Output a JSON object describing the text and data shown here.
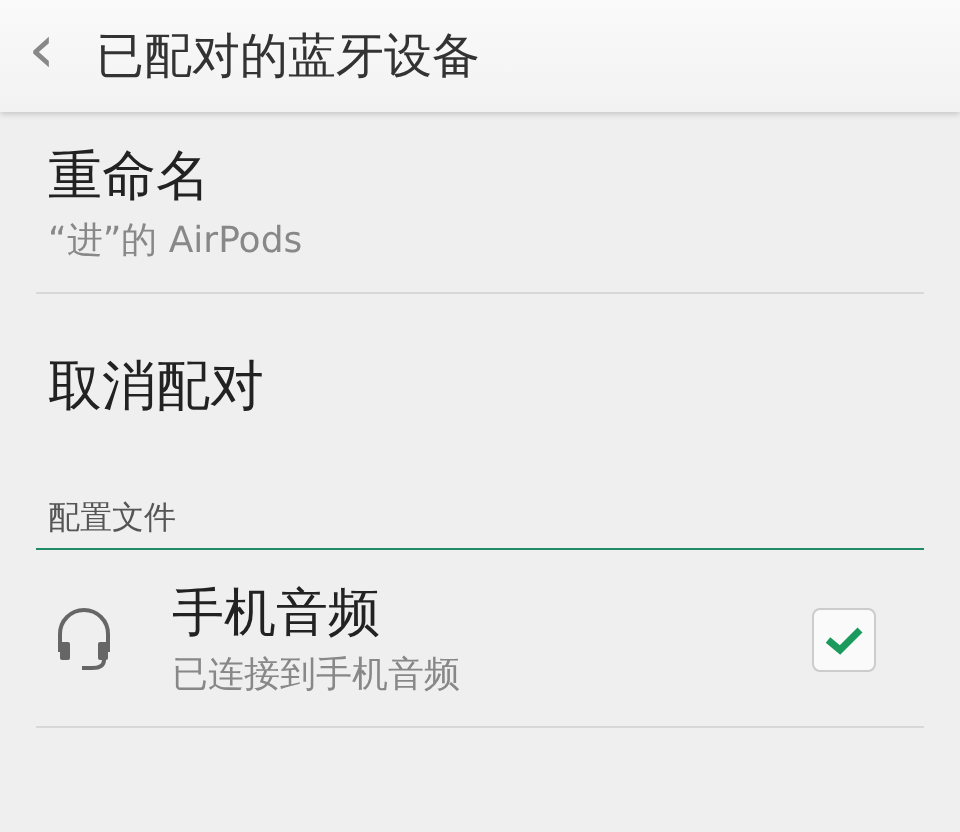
{
  "header": {
    "back": "‹",
    "title": "已配对的蓝牙设备"
  },
  "items": [
    {
      "title": "重命名",
      "subtitle": "“进”的 AirPods"
    },
    {
      "title": "取消配对"
    }
  ],
  "section": {
    "title": "配置文件"
  },
  "profiles": [
    {
      "title": "手机音频",
      "subtitle": "已连接到手机音频",
      "checked": true
    }
  ]
}
